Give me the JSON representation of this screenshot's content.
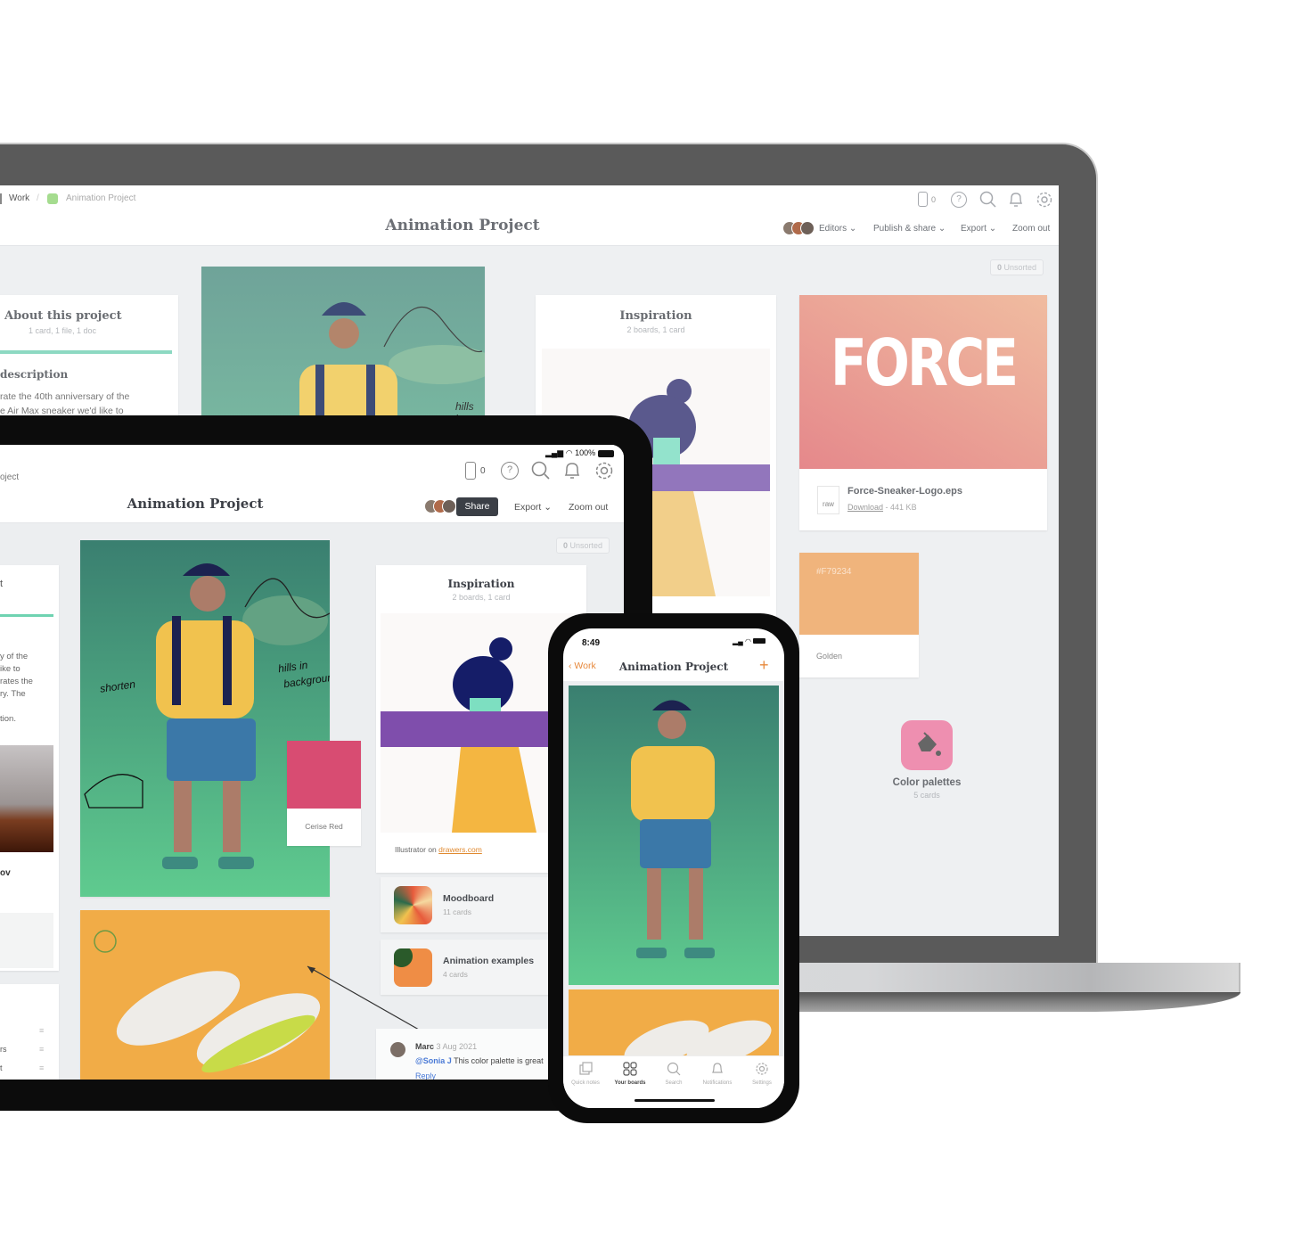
{
  "laptop": {
    "breadcrumb": {
      "parent": "Work",
      "separator": "/",
      "current": "Animation Project",
      "current_color": "#a5dc8f"
    },
    "title": "Animation Project",
    "toolbar_icons": {
      "device_count": "0",
      "icons": [
        "phone-icon",
        "help-icon",
        "search-icon",
        "bell-icon",
        "gear-icon"
      ]
    },
    "actions": {
      "editors": "Editors",
      "publish": "Publish & share",
      "export": "Export",
      "zoom_out": "Zoom out"
    },
    "unsorted": {
      "count": "0",
      "label": "Unsorted"
    },
    "about": {
      "title": "About this project",
      "meta": "1 card, 1 file, 1 doc",
      "section": "description",
      "body_line1": "rate the 40th anniversary of the",
      "body_line2": "e Air Max sneaker we'd like to"
    },
    "illustration_note": "hills in",
    "inspiration": {
      "title": "Inspiration",
      "meta": "2 boards, 1 card"
    },
    "file_card": {
      "logo_text": "FORCE",
      "file_type": "raw",
      "file_name": "Force-Sneaker-Logo.eps",
      "download": "Download",
      "size": "- 441 KB"
    },
    "swatch": {
      "hex": "#F79234",
      "name": "Golden",
      "color": "#f0b47c"
    },
    "board": {
      "title": "Color palettes",
      "meta": "5 cards",
      "color": "#ee8fb0"
    }
  },
  "tablet": {
    "status": {
      "battery": "100%"
    },
    "breadcrumb_partial": "oject",
    "device_count": "0",
    "title": "Animation Project",
    "share": "Share",
    "export": "Export",
    "zoom_out": "Zoom out",
    "unsorted": {
      "count": "0",
      "label": "Unsorted"
    },
    "left_card": {
      "lines": [
        "y of the",
        "ike to",
        "rates the",
        "ry. The",
        "",
        "tion."
      ],
      "caption": "ov",
      "list_items": [
        "",
        "rs",
        "t"
      ]
    },
    "annotations": {
      "shorten": "shorten",
      "hills": "hills in",
      "hills2": "background"
    },
    "swatch": {
      "name": "Cerise Red",
      "color": "#d84c72"
    },
    "inspiration": {
      "title": "Inspiration",
      "meta": "2 boards, 1 card",
      "credit_prefix": "Illustrator on",
      "credit_link": "drawers.com"
    },
    "boards": [
      {
        "title": "Moodboard",
        "meta": "11 cards"
      },
      {
        "title": "Animation examples",
        "meta": "4 cards"
      }
    ],
    "comment": {
      "author": "Marc",
      "date": "3 Aug 2021",
      "mention": "@Sonia J",
      "text": "This color palette is great",
      "reply": "Reply"
    }
  },
  "phone": {
    "time": "8:49",
    "back": "Work",
    "title": "Animation Project",
    "add": "+",
    "tabs": [
      {
        "label": "Quick notes",
        "icon": "notes-icon"
      },
      {
        "label": "Your boards",
        "icon": "boards-icon",
        "active": true
      },
      {
        "label": "Search",
        "icon": "search-icon"
      },
      {
        "label": "Notifications",
        "icon": "bell-icon"
      },
      {
        "label": "Settings",
        "icon": "gear-icon"
      }
    ]
  }
}
